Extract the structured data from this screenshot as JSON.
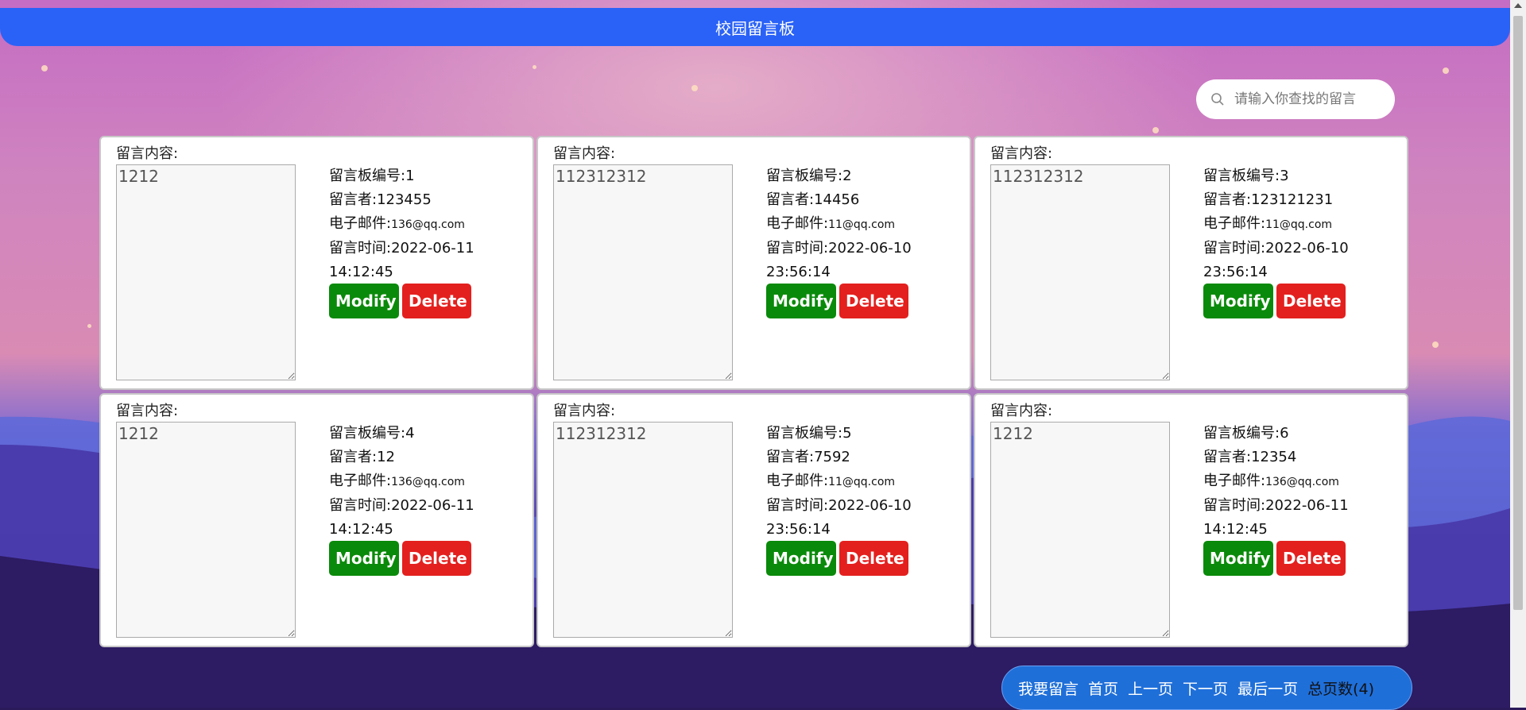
{
  "header": {
    "title": "校园留言板"
  },
  "search": {
    "placeholder": "请输入你查找的留言"
  },
  "labels": {
    "content_label": "留言内容:",
    "id_label": "留言板编号:",
    "author_label": "留言者:",
    "email_label": "电子邮件:",
    "time_label": "留言时间:",
    "modify": "Modify",
    "delete": "Delete"
  },
  "messages": [
    {
      "content": "1212",
      "id": "1",
      "author": "123455",
      "email": "136@qq.com",
      "date": "2022-06-11",
      "time": "14:12:45"
    },
    {
      "content": "112312312",
      "id": "2",
      "author": "14456",
      "email": "11@qq.com",
      "date": "2022-06-10",
      "time": "23:56:14"
    },
    {
      "content": "112312312",
      "id": "3",
      "author": "123121231",
      "email": "11@qq.com",
      "date": "2022-06-10",
      "time": "23:56:14"
    },
    {
      "content": "1212",
      "id": "4",
      "author": "12",
      "email": "136@qq.com",
      "date": "2022-06-11",
      "time": "14:12:45"
    },
    {
      "content": "112312312",
      "id": "5",
      "author": "7592",
      "email": "11@qq.com",
      "date": "2022-06-10",
      "time": "23:56:14"
    },
    {
      "content": "1212",
      "id": "6",
      "author": "12354",
      "email": "136@qq.com",
      "date": "2022-06-11",
      "time": "14:12:45"
    }
  ],
  "pager": {
    "leave_message": "我要留言",
    "first": "首页",
    "prev": "上一页",
    "next": "下一页",
    "last": "最后一页",
    "total": "总页数(4)"
  },
  "icons": {
    "search": "search-icon"
  },
  "colors": {
    "header": "#2a62f7",
    "modify": "#0a8a0a",
    "delete": "#e3201e",
    "pager": "#1f6fd9"
  }
}
